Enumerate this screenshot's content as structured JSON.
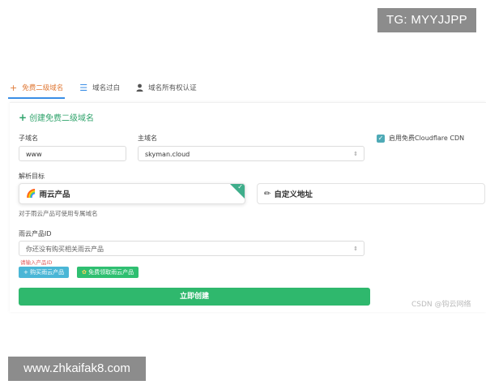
{
  "overlay": {
    "tg_badge": "TG: MYYJJPP",
    "site_badge": "www.zhkaifak8.com",
    "csdn_watermark": "CSDN @钩云网络"
  },
  "tabs": [
    {
      "label": "免费二级域名",
      "icon": "plus-icon",
      "active": true
    },
    {
      "label": "域名过白",
      "icon": "list-icon",
      "active": false
    },
    {
      "label": "域名所有权认证",
      "icon": "user-icon",
      "active": false
    }
  ],
  "form": {
    "section_title": "创建免费二级域名",
    "subdomain": {
      "label": "子域名",
      "value": "www"
    },
    "domain": {
      "label": "主域名",
      "value": "skyman.cloud"
    },
    "cdn_checkbox": {
      "label": "启用免费Cloudflare CDN",
      "checked": true
    },
    "target_label": "解析目标",
    "target_options": [
      {
        "label": "雨云产品",
        "icon": "rainbow-icon",
        "selected": true
      },
      {
        "label": "自定义地址",
        "icon": "pen-icon",
        "selected": false
      }
    ],
    "target_hint": "对于雨云产品可使用专属域名",
    "product_id": {
      "label": "雨云产品ID",
      "placeholder": "你还没有购买相关雨云产品",
      "error": "请输入产品ID"
    },
    "buy_button": "+ 购买雨云产品",
    "free_button": "免费领取雨云产品",
    "submit_button": "立即创建"
  },
  "colors": {
    "accent_green": "#2fb86d",
    "tab_active": "#e07b39",
    "checkbox": "#4eaab6"
  }
}
